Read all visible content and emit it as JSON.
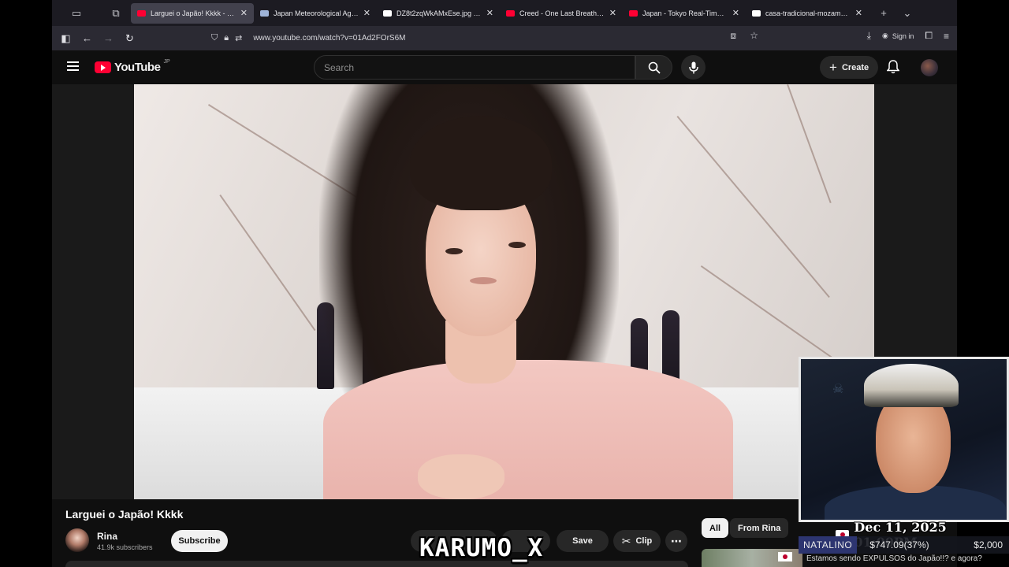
{
  "browser": {
    "tabs": [
      {
        "title": "Larguei o Japão! Kkkk - YouTube",
        "favicon": "youtube-icon",
        "active": true,
        "color": "#ff0033"
      },
      {
        "title": "Japan Meteorological Agency",
        "favicon": "page-icon",
        "active": false,
        "color": "#9fb4d8"
      },
      {
        "title": "DZ8t2zqWkAMxEse.jpg (JPEG Image)",
        "favicon": "x-icon",
        "active": false,
        "color": "#ffffff"
      },
      {
        "title": "Creed - One Last Breath (Official)",
        "favicon": "youtube-icon",
        "active": false,
        "color": "#ff0033"
      },
      {
        "title": "Japan - Tokyo Real-Time Earthquake",
        "favicon": "youtube-icon",
        "active": false,
        "color": "#ff0033"
      },
      {
        "title": "casa-tradicional-mozambique",
        "favicon": "tiktok-icon",
        "active": false,
        "color": "#ffffff"
      }
    ],
    "url": "www.youtube.com/watch?v=01Ad2FOrS6M",
    "sign_in": "Sign in"
  },
  "youtube": {
    "logo_text": "YouTube",
    "country_code": "JP",
    "search_placeholder": "Search",
    "create_label": "Create"
  },
  "video": {
    "title": "Larguei o Japão! Kkkk",
    "channel_name": "Rina",
    "subscribers": "41.9k subscribers",
    "subscribe_label": "Subscribe",
    "save_label": "Save",
    "clip_label": "Clip"
  },
  "chips": {
    "all": "All",
    "from_channel": "From Rina"
  },
  "related": {
    "first_title": "Estamos sendo EXPULSOS do Japão!!? e agora?"
  },
  "overlay": {
    "watermark": "KARUMO_X",
    "datetime": "Dec 11, 2025 01:00PM",
    "ticker_name": "NATALINO",
    "ticker_amount": "$747.09(37%)",
    "ticker_goal": "$2,000"
  },
  "colors": {
    "youtube_red": "#ff0033",
    "page_bg": "#0f0f0f",
    "ticker_accent": "#2d3570"
  }
}
